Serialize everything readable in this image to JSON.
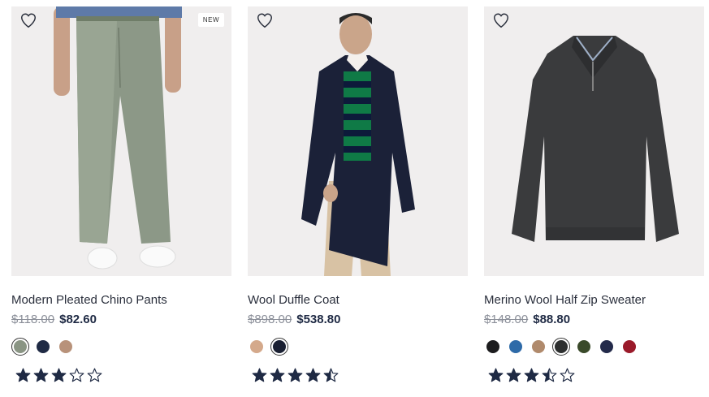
{
  "products": [
    {
      "name": "Modern Pleated Chino Pants",
      "badge": "NEW",
      "original_price": "$118.00",
      "sale_price": "$82.60",
      "rating": 3,
      "swatches": [
        {
          "color": "#8a9584",
          "selected": true
        },
        {
          "color": "#1f2a44",
          "selected": false
        },
        {
          "color": "#b8927a",
          "selected": false
        }
      ],
      "image": {
        "bg": "#f0eeee",
        "type": "pants"
      }
    },
    {
      "name": "Wool Duffle Coat",
      "badge": "",
      "original_price": "$898.00",
      "sale_price": "$538.80",
      "rating": 4.5,
      "swatches": [
        {
          "color": "#d4a98b",
          "selected": false
        },
        {
          "color": "#1a2033",
          "selected": true
        }
      ],
      "image": {
        "bg": "#f0eeee",
        "type": "coat"
      }
    },
    {
      "name": "Merino Wool Half Zip Sweater",
      "badge": "",
      "original_price": "$148.00",
      "sale_price": "$88.80",
      "rating": 3.5,
      "swatches": [
        {
          "color": "#1c1c1e",
          "selected": false
        },
        {
          "color": "#2e6aa8",
          "selected": false
        },
        {
          "color": "#b08a6c",
          "selected": false
        },
        {
          "color": "#2d2f2f",
          "selected": true
        },
        {
          "color": "#3a4a2a",
          "selected": false
        },
        {
          "color": "#232a4a",
          "selected": false
        },
        {
          "color": "#9a1a2a",
          "selected": false
        }
      ],
      "image": {
        "bg": "#f0eeee",
        "type": "sweater"
      }
    }
  ],
  "icons": {
    "wishlist": "heart-outline-icon",
    "rating": "star-icon"
  },
  "colors": {
    "text": "#2a2f3c",
    "price": "#1f2a44",
    "strike": "#8b8f99",
    "star": "#1f2a44"
  }
}
